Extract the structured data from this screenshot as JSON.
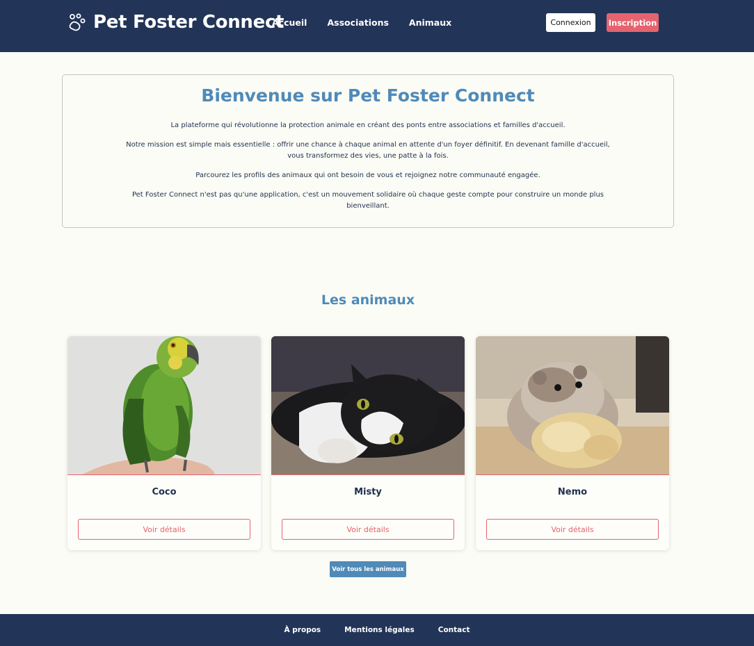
{
  "colors": {
    "navbar_bg": "#223457",
    "accent_blue": "#4f8ab8",
    "accent_coral": "#e5636f",
    "page_bg": "#fbfcf5"
  },
  "navbar": {
    "brand_icon": "paw-icon",
    "brand_name": "Pet Foster Connect",
    "links": [
      "Accueil",
      "Associations",
      "Animaux"
    ],
    "login_label": "Connexion",
    "signup_label": "Inscription"
  },
  "welcome": {
    "title": "Bienvenue sur Pet Foster Connect",
    "paragraphs": [
      "La plateforme qui révolutionne la protection animale en créant des ponts entre associations et familles d'accueil.",
      "Notre mission est simple mais essentielle : offrir une chance à chaque animal en attente d'un foyer définitif. En devenant famille d'accueil, vous transformez des vies, une patte à la fois.",
      "Parcourez les profils des animaux qui ont besoin de vous et rejoignez notre communauté engagée.",
      "Pet Foster Connect n'est pas qu'une application, c'est un mouvement solidaire où chaque geste compte pour construire un monde plus bienveillant."
    ]
  },
  "animals": {
    "title": "Les animaux",
    "cards": [
      {
        "name": "Coco",
        "details_label": "Voir détails"
      },
      {
        "name": "Misty",
        "details_label": "Voir détails"
      },
      {
        "name": "Nemo",
        "details_label": "Voir détails"
      }
    ],
    "see_all_label": "Voir tous les animaux"
  },
  "footer": {
    "links": [
      "À propos",
      "Mentions légales",
      "Contact"
    ]
  }
}
